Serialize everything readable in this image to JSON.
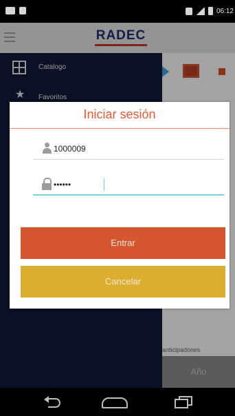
{
  "status_bar": {
    "time": "06:12"
  },
  "app_bar": {
    "logo_text": "RADEC"
  },
  "drawer": {
    "items": [
      {
        "label": "Catalogo",
        "icon": "grid-icon"
      },
      {
        "label": "Favoritos",
        "icon": "star-icon"
      }
    ]
  },
  "background": {
    "partial_text": "anticipadones",
    "footer_label": "Año"
  },
  "login_dialog": {
    "title": "Iniciar sesión",
    "username_value": "1000009",
    "password_value": "••••••",
    "submit_label": "Entrar",
    "cancel_label": "Cancelar"
  },
  "colors": {
    "accent": "#e35a34",
    "primary_button": "#d5572f",
    "secondary_button": "#dcae2f",
    "drawer_bg": "#121938",
    "focus_underline": "#7bd3e7"
  }
}
